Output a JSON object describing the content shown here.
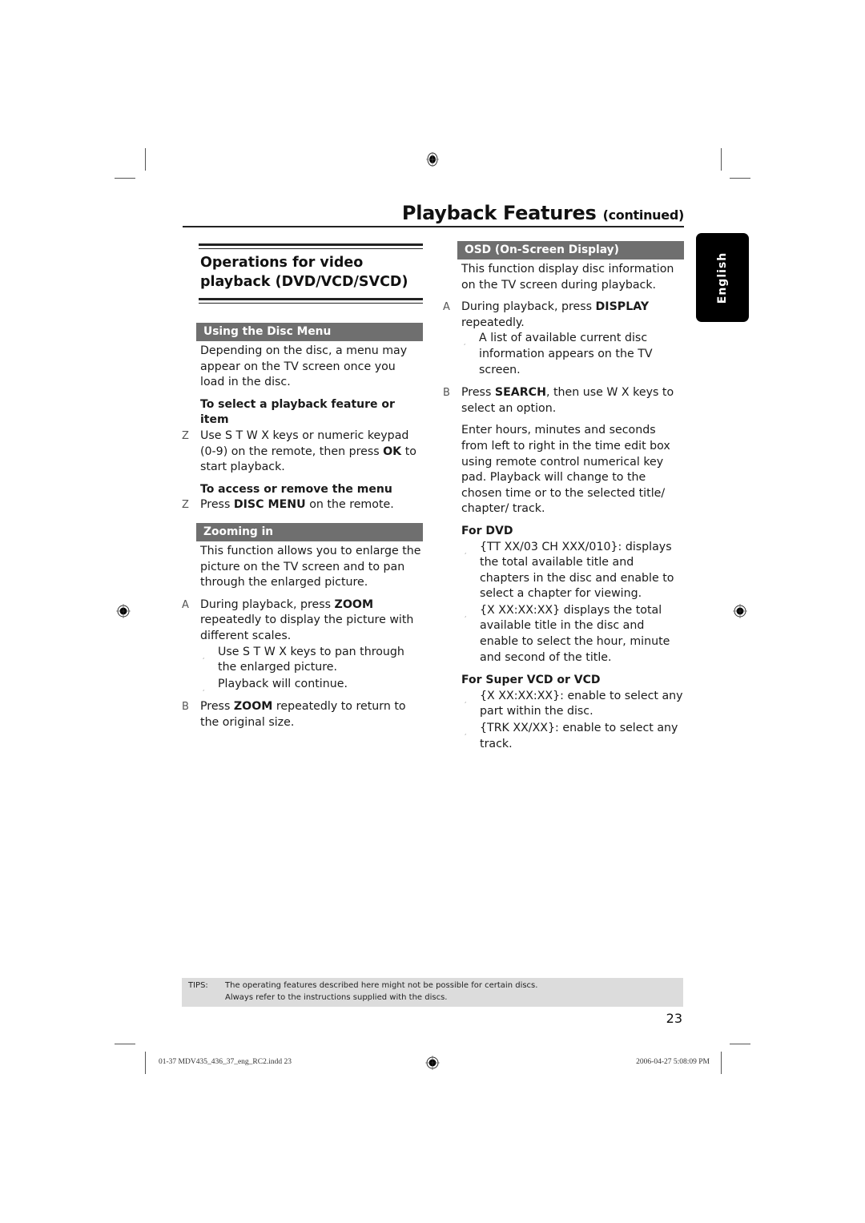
{
  "header": {
    "title": "Playback Features",
    "title_suffix": "(continued)"
  },
  "language_tab": "English",
  "left_column": {
    "section_title_line1": "Operations for video",
    "section_title_line2": "playback (DVD/VCD/SVCD)",
    "disc_menu": {
      "heading": "Using the Disc Menu",
      "intro": "Depending on the disc, a menu may appear on the TV screen once you load in the disc.",
      "sub1": {
        "title": "To select a playback feature or item",
        "marker": "Z",
        "text_pre": "Use  S  T   W X keys or numeric keypad (0-9) on the remote, then press ",
        "bold": "OK",
        "text_post": " to start playback."
      },
      "sub2": {
        "title": "To access or remove the menu",
        "marker": "Z",
        "text_pre": "Press ",
        "bold": "DISC MENU",
        "text_post": " on the remote."
      }
    },
    "zooming": {
      "heading": "Zooming in",
      "intro": "This function allows you to enlarge the picture on the TV screen and to pan through the enlarged picture.",
      "stepA": {
        "marker": "A",
        "text_pre": "During playback, press ",
        "bold": "ZOOM",
        "text_post": " repeatedly to display the picture with different scales."
      },
      "bullets": [
        "Use  S  T   W X keys to pan through the enlarged picture.",
        "Playback will continue."
      ],
      "stepB": {
        "marker": "B",
        "text_pre": "Press ",
        "bold": "ZOOM",
        "text_post": " repeatedly to return to the original size."
      }
    }
  },
  "right_column": {
    "osd": {
      "heading": "OSD (On-Screen Display)",
      "intro": "This function display disc information on the TV screen during playback.",
      "stepA": {
        "marker": "A",
        "text_pre": "During playback, press ",
        "bold": "DISPLAY",
        "text_post": " repeatedly."
      },
      "stepA_bullet": "A list of available current disc information appears on the TV screen.",
      "stepB": {
        "marker": "B",
        "text_pre": "Press ",
        "bold": "SEARCH",
        "text_post": ", then use  W X keys to select an option."
      },
      "search_note": "Enter hours, minutes and seconds from left to right in the time edit box using remote control numerical key pad. Playback will change to the chosen time or to the selected title/ chapter/ track.",
      "for_dvd": {
        "title": "For DVD",
        "bullets": [
          "{TT XX/03 CH XXX/010}: displays the total available title and chapters in the disc and enable to select a chapter for viewing.",
          "{X   XX:XX:XX} displays the total available title in the disc and enable to select the hour, minute and second of the title."
        ]
      },
      "for_vcd": {
        "title": "For Super VCD or VCD",
        "bullets": [
          "{X   XX:XX:XX}: enable to select any part within the disc.",
          "{TRK XX/XX}: enable to select any track."
        ]
      }
    }
  },
  "tips": {
    "label": "TIPS:",
    "line1": "The operating features described here might not be possible for certain discs.",
    "line2": "Always refer to the instructions supplied with the discs."
  },
  "page_number": "23",
  "slug": {
    "file": "01-37 MDV435_436_37_eng_RC2.indd   23",
    "timestamp": "2006-04-27   5:08:09 PM"
  },
  "bullet_glyph": "¸",
  "colors": {
    "bar": "#6f6f6f",
    "tips_bg": "#dcdcdc",
    "tab_bg": "#000000"
  }
}
